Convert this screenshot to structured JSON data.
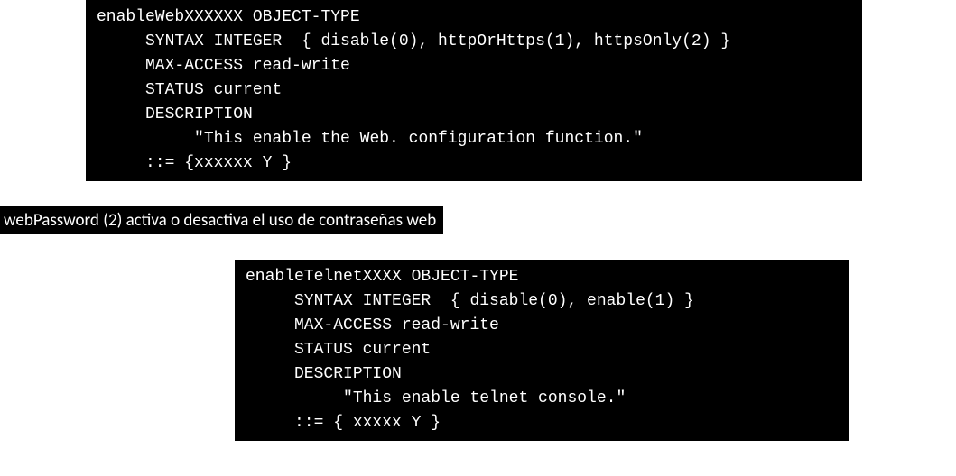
{
  "code1": {
    "l1": "enableWebXXXXXX OBJECT-TYPE",
    "l2": "     SYNTAX INTEGER  { disable(0), httpOrHttps(1), httpsOnly(2) }",
    "l3": "     MAX-ACCESS read-write",
    "l4": "     STATUS current",
    "l5": "     DESCRIPTION",
    "l6": "          \"This enable the Web. configuration function.\"",
    "l7": "     ::= {xxxxxx Y }"
  },
  "label": "webPassword (2) activa o desactiva el uso de contraseñas web",
  "code2": {
    "l1": "enableTelnetXXXX OBJECT-TYPE",
    "l2": "     SYNTAX INTEGER  { disable(0), enable(1) }",
    "l3": "     MAX-ACCESS read-write",
    "l4": "     STATUS current",
    "l5": "     DESCRIPTION",
    "l6": "          \"This enable telnet console.\"",
    "l7": "     ::= { xxxxx Y }"
  }
}
